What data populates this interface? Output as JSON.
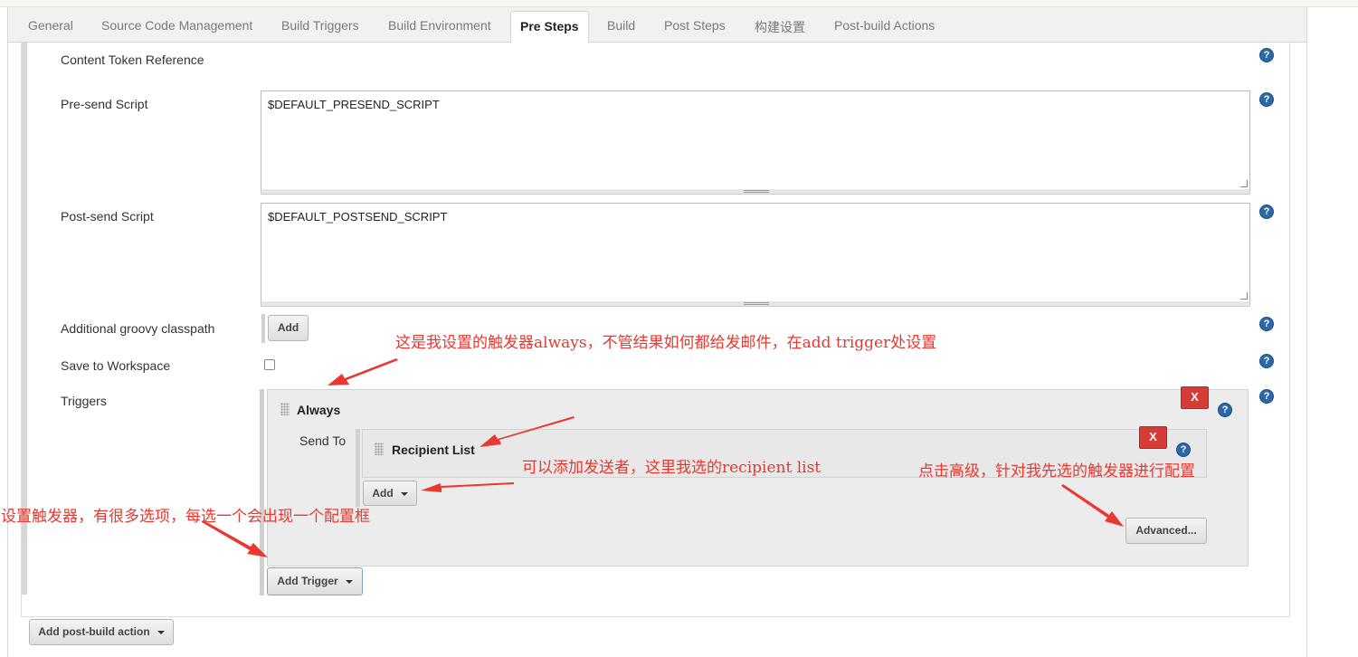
{
  "tabs": [
    {
      "label": "General",
      "active": false
    },
    {
      "label": "Source Code Management",
      "active": false
    },
    {
      "label": "Build Triggers",
      "active": false
    },
    {
      "label": "Build Environment",
      "active": false
    },
    {
      "label": "Pre Steps",
      "active": true
    },
    {
      "label": "Build",
      "active": false
    },
    {
      "label": "Post Steps",
      "active": false
    },
    {
      "label": "构建设置",
      "active": false
    },
    {
      "label": "Post-build Actions",
      "active": false
    }
  ],
  "fields": {
    "content_token_reference": "Content Token Reference",
    "presend_label": "Pre-send Script",
    "presend_value": "$DEFAULT_PRESEND_SCRIPT",
    "postsend_label": "Post-send Script",
    "postsend_value": "$DEFAULT_POSTSEND_SCRIPT",
    "groovy_label": "Additional groovy classpath",
    "groovy_add": "Add",
    "save_workspace_label": "Save to Workspace",
    "triggers_label": "Triggers"
  },
  "trigger": {
    "name": "Always",
    "delete": "X",
    "send_to_label": "Send To",
    "recipient": "Recipient List",
    "recipient_delete": "X",
    "add_label": "Add",
    "advanced_label": "Advanced...",
    "add_trigger_label": "Add Trigger"
  },
  "footer": {
    "add_post_build": "Add post-build action"
  },
  "annotations": {
    "a1": "这是我设置的触发器always，不管结果如何都给发邮件，在add trigger处设置",
    "a2": "可以添加发送者，这里我选的recipient list",
    "a3": "点击高级，针对我先选的触发器进行配置",
    "a4": "设置触发器，有很多选项，每选一个会出现一个配置框"
  },
  "colors": {
    "annotation": "#e8382f",
    "help_icon": "#2c67a6",
    "delete_button": "#d63c35"
  }
}
